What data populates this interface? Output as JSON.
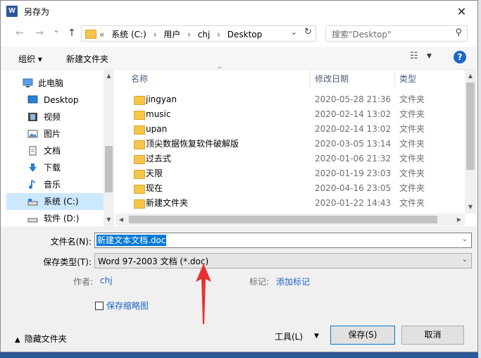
{
  "window": {
    "title": "另存为",
    "app_icon": "word-icon",
    "close_glyph": "✕"
  },
  "nav": {
    "back_glyph": "←",
    "forward_glyph": "→",
    "dropdown_glyph": "⌄",
    "up_glyph": "↑",
    "breadcrumb": [
      "«",
      "系统 (C:)",
      "›",
      "用户",
      "›",
      "chj",
      "›",
      "Desktop"
    ],
    "search_placeholder": "搜索\"Desktop\""
  },
  "toolbar": {
    "organize_label": "组织 ▾",
    "new_folder_label": "新建文件夹",
    "help_label": "?"
  },
  "sidebar": {
    "items": [
      {
        "label": "此电脑",
        "icon": "computer-icon"
      },
      {
        "label": "Desktop",
        "icon": "desktop-icon"
      },
      {
        "label": "视频",
        "icon": "video-icon"
      },
      {
        "label": "图片",
        "icon": "pictures-icon"
      },
      {
        "label": "文档",
        "icon": "documents-icon"
      },
      {
        "label": "下载",
        "icon": "download-icon"
      },
      {
        "label": "音乐",
        "icon": "music-icon"
      },
      {
        "label": "系统 (C:)",
        "icon": "drive-icon",
        "selected": true
      },
      {
        "label": "软件 (D:)",
        "icon": "drive-icon"
      }
    ]
  },
  "filelist": {
    "columns": [
      "名称",
      "修改日期",
      "类型"
    ],
    "rows": [
      {
        "name": "jingyan",
        "date": "2020-05-28 21:36",
        "type": "文件夹"
      },
      {
        "name": "music",
        "date": "2020-02-14 13:02",
        "type": "文件夹"
      },
      {
        "name": "upan",
        "date": "2020-02-14 13:02",
        "type": "文件夹"
      },
      {
        "name": "顶尖数据恢复软件破解版",
        "date": "2020-03-05 13:14",
        "type": "文件夹"
      },
      {
        "name": "过去式",
        "date": "2020-01-06 21:32",
        "type": "文件夹"
      },
      {
        "name": "天限",
        "date": "2020-01-19 23:03",
        "type": "文件夹"
      },
      {
        "name": "现在",
        "date": "2020-04-16 23:05",
        "type": "文件夹"
      },
      {
        "name": "新建文件夹",
        "date": "2020-01-22 14:43",
        "type": "文件夹"
      }
    ]
  },
  "form": {
    "filename_label": "文件名(N):",
    "filename_value": "新建文本文档.doc",
    "filetype_label": "保存类型(T):",
    "filetype_value": "Word 97-2003 文档 (*.doc)",
    "author_label": "作者:",
    "author_value": "chj",
    "tags_label": "标记:",
    "tags_value": "添加标记",
    "thumbnail_label": "保存缩略图",
    "thumbnail_checked": false
  },
  "footer": {
    "hide_folders_label": "隐藏文件夹",
    "tools_label": "工具(L)",
    "save_label": "保存(S)",
    "cancel_label": "取消"
  },
  "colors": {
    "accent": "#0078d7",
    "link": "#1e66c8",
    "annotation_arrow": "#e8312f",
    "selection": "#cce8ff"
  }
}
